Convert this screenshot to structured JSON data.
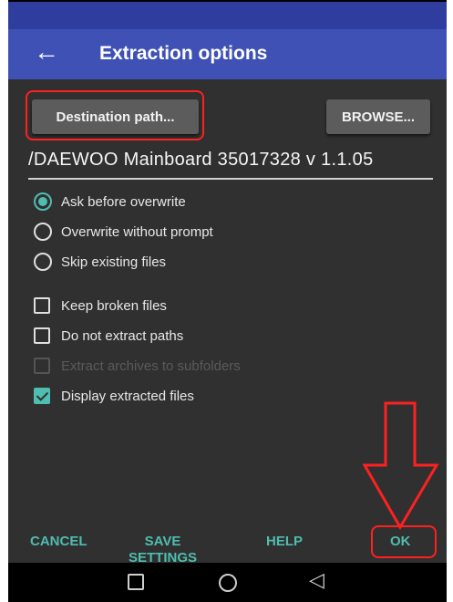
{
  "appbar": {
    "title": "Extraction options",
    "back_icon": "arrow-left-icon"
  },
  "buttons": {
    "destination": "Destination path...",
    "browse": "BROWSE..."
  },
  "path_value": "/DAEWOO Mainboard 35017328 v 1.1.05",
  "overwrite_options": [
    {
      "label": "Ask before overwrite",
      "selected": true
    },
    {
      "label": "Overwrite without prompt",
      "selected": false
    },
    {
      "label": "Skip existing files",
      "selected": false
    }
  ],
  "checkboxes": [
    {
      "label": "Keep broken files",
      "checked": false,
      "enabled": true
    },
    {
      "label": "Do not extract paths",
      "checked": false,
      "enabled": true
    },
    {
      "label": "Extract archives to subfolders",
      "checked": false,
      "enabled": false
    },
    {
      "label": "Display extracted files",
      "checked": true,
      "enabled": true
    }
  ],
  "actions": {
    "cancel": "CANCEL",
    "save_line1": "SAVE",
    "save_line2": "SETTINGS",
    "help": "HELP",
    "ok": "OK"
  },
  "colors": {
    "accent": "#4fbdb0",
    "appbar": "#3f51b5",
    "annotation": "#ff2020",
    "background": "#303030"
  }
}
